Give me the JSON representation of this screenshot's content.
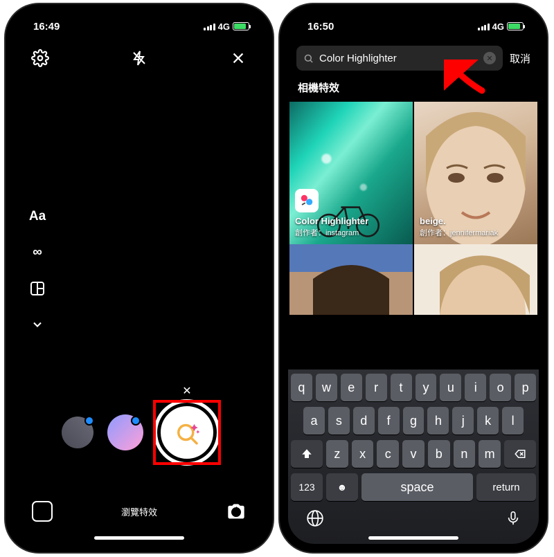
{
  "left": {
    "status": {
      "time": "16:49",
      "network": "4G"
    },
    "tools": {
      "text": "Aa",
      "infinity": "∞"
    },
    "bottom": {
      "browse_effects": "瀏覽特效"
    }
  },
  "right": {
    "status": {
      "time": "16:50",
      "network": "4G"
    },
    "search": {
      "value": "Color Highlighter",
      "cancel": "取消"
    },
    "section": "相機特效",
    "effects": [
      {
        "name": "Color Highlighter",
        "author_label": "創作者：",
        "author": "instagram"
      },
      {
        "name": "beige.",
        "author_label": "創作者：",
        "author": "jennifermariak"
      }
    ],
    "keyboard": {
      "rows": [
        [
          "q",
          "w",
          "e",
          "r",
          "t",
          "y",
          "u",
          "i",
          "o",
          "p"
        ],
        [
          "a",
          "s",
          "d",
          "f",
          "g",
          "h",
          "j",
          "k",
          "l"
        ],
        [
          "z",
          "x",
          "c",
          "v",
          "b",
          "n",
          "m"
        ]
      ],
      "num": "123",
      "space": "space",
      "ret": "return"
    }
  }
}
